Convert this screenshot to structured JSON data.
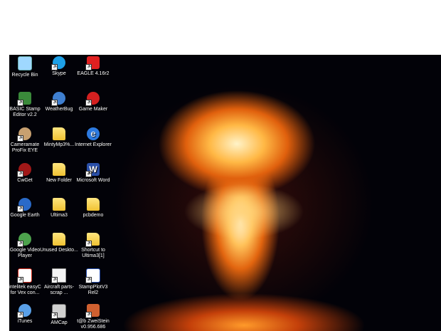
{
  "desktop": {
    "icons": [
      {
        "label": "Recycle Bin",
        "icon": "recycle-bin-icon",
        "color": "#9fd8ff"
      },
      {
        "label": "Skype",
        "icon": "skype-icon",
        "color": "#1ea0e6"
      },
      {
        "label": "EAGLE 4.16r2",
        "icon": "eagle-icon",
        "color": "#e02020"
      },
      {
        "label": "BASIC Stamp Editor v2.2",
        "icon": "chip-icon",
        "color": "#3a8a3a"
      },
      {
        "label": "WeatherBug",
        "icon": "weatherbug-icon",
        "color": "#3f7fd0"
      },
      {
        "label": "Game Maker",
        "icon": "game-maker-icon",
        "color": "#d42020"
      },
      {
        "label": "Cameramate ProFix EYE",
        "icon": "camera-icon",
        "color": "#c8a070"
      },
      {
        "label": "MintyMp3%...",
        "icon": "folder-icon",
        "color": "#f0c232"
      },
      {
        "label": "Internet Explorer",
        "icon": "internet-explorer-icon",
        "color": "#2d7ae0"
      },
      {
        "label": "CwGet",
        "icon": "cwget-icon",
        "color": "#a01818"
      },
      {
        "label": "New Folder",
        "icon": "folder-icon",
        "color": "#f0c232"
      },
      {
        "label": "Microsoft Word",
        "icon": "word-icon",
        "color": "#2a4fa8"
      },
      {
        "label": "Google Earth",
        "icon": "google-earth-icon",
        "color": "#2a6ac8"
      },
      {
        "label": "Ultima3",
        "icon": "folder-icon",
        "color": "#f0c232"
      },
      {
        "label": "pcbdemo",
        "icon": "folder-zip-icon",
        "color": "#f0c232"
      },
      {
        "label": "Google Video Player",
        "icon": "video-player-icon",
        "color": "#4da34d"
      },
      {
        "label": "Unused Deskto...",
        "icon": "folder-icon",
        "color": "#f0c232"
      },
      {
        "label": "Shortcut to Ultima3[1]",
        "icon": "folder-shortcut-icon",
        "color": "#f0c232"
      },
      {
        "label": "intelitek easyC for Vex con...",
        "icon": "easyc-icon",
        "color": "#d83020"
      },
      {
        "label": "Aircraft parts-scrap ...",
        "icon": "document-icon",
        "color": "#f4f4f4"
      },
      {
        "label": "StampPlotV3 Rel2",
        "icon": "stampplot-icon",
        "color": "#2850b0"
      },
      {
        "label": "iTunes",
        "icon": "itunes-icon",
        "color": "#5aa0e8"
      },
      {
        "label": "AMCap",
        "icon": "amcap-icon",
        "color": "#d0d0d0"
      },
      {
        "label": "t@b ZweiStein v0.956.686",
        "icon": "zweistein-icon",
        "color": "#d06030"
      }
    ]
  }
}
